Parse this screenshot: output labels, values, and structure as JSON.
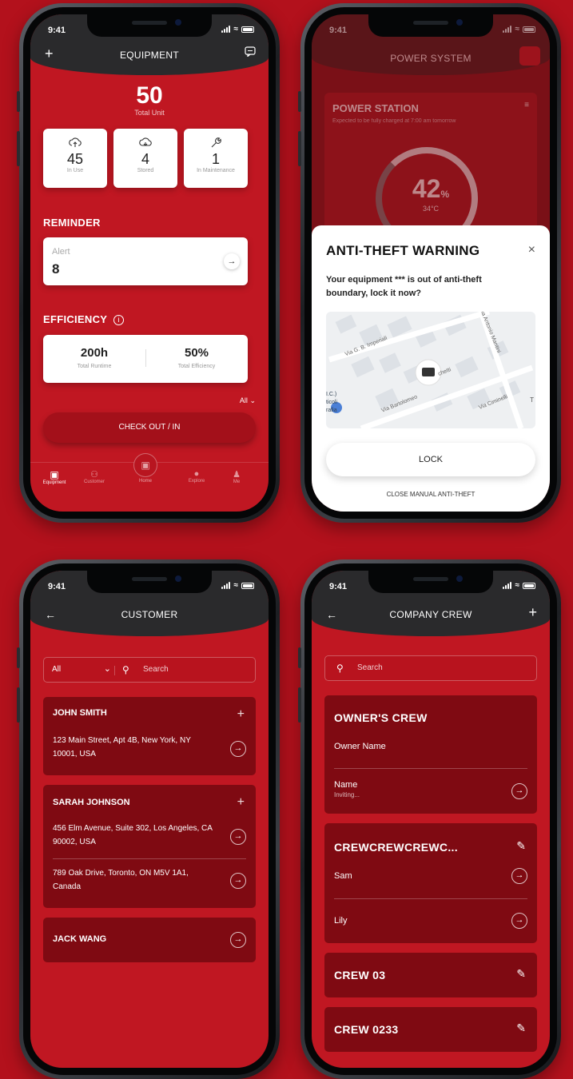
{
  "status": {
    "time": "9:41"
  },
  "equipment": {
    "header_title": "EQUIPMENT",
    "total_value": "50",
    "total_label": "Total Unit",
    "stats": [
      {
        "value": "45",
        "label": "In Use",
        "icon": "cloud-upload-icon"
      },
      {
        "value": "4",
        "label": "Stored",
        "icon": "cloud-icon"
      },
      {
        "value": "1",
        "label": "In Maintenance",
        "icon": "wrench-icon"
      }
    ],
    "reminder_title": "REMINDER",
    "alert_label": "Alert",
    "alert_value": "8",
    "efficiency_title": "EFFICIENCY",
    "runtime_value": "200h",
    "runtime_label": "Total Runtime",
    "efficiency_value": "50%",
    "efficiency_label": "Total Efficiency",
    "filter_label": "All",
    "checkout_label": "CHECK OUT / IN",
    "tabs": [
      "Equipment",
      "Customer",
      "Home",
      "Explore",
      "Me"
    ]
  },
  "power": {
    "header_title": "POWER SYSTEM",
    "station_title": "POWER STATION",
    "station_sub": "Expected to be fully charged at 7:00 am tomorrow",
    "percent": "42",
    "percent_unit": "%",
    "temp": "34°C",
    "modal_title": "ANTI-THEFT WARNING",
    "modal_text": "Your equipment *** is out of anti-theft boundary, lock it now?",
    "map_labels": [
      "Via G. B. Imperiali",
      "Via Antonio Mantini",
      "Via Bartolomeo",
      "chetti",
      "Via Ciminelli",
      "I.C.)",
      "ticoli",
      "rafia",
      "T"
    ],
    "lock_label": "LOCK",
    "close_label": "CLOSE MANUAL ANTI-THEFT"
  },
  "customer": {
    "header_title": "CUSTOMER",
    "filter_value": "All",
    "search_placeholder": "Search",
    "customers": [
      {
        "name": "JOHN SMITH",
        "addresses": [
          "123 Main Street, Apt 4B, New York, NY 10001, USA"
        ]
      },
      {
        "name": "SARAH JOHNSON",
        "addresses": [
          "456 Elm Avenue, Suite 302, Los Angeles, CA 90002, USA",
          "789 Oak Drive, Toronto, ON M5V 1A1, Canada"
        ]
      },
      {
        "name": "JACK WANG",
        "addresses": []
      }
    ]
  },
  "crew": {
    "header_title": "COMPANY CREW",
    "search_placeholder": "Search",
    "owners_title": "OWNER'S CREW",
    "owner_name": "Owner Name",
    "member_name": "Name",
    "member_status": "Inviting...",
    "crews": [
      {
        "title": "CREWCREWCREWC...",
        "members": [
          "Sam",
          "Lily"
        ]
      },
      {
        "title": "CREW 03",
        "members": []
      },
      {
        "title": "CREW 0233",
        "members": []
      }
    ]
  },
  "colors": {
    "background": "#b3111c",
    "screen": "#c01722",
    "card_dark": "#7f0a12",
    "header": "#2a2a2c"
  }
}
